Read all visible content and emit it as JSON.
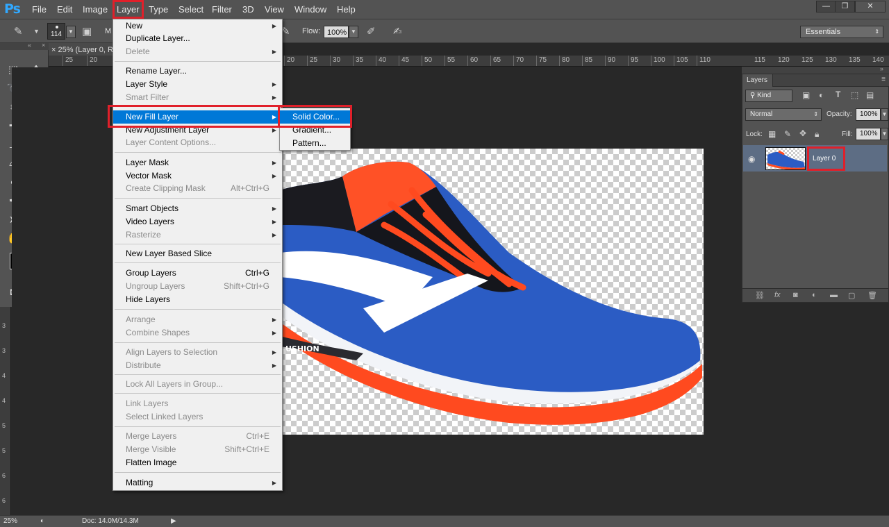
{
  "app": {
    "logo": "Ps"
  },
  "menubar": {
    "items": [
      "File",
      "Edit",
      "Image",
      "Layer",
      "Type",
      "Select",
      "Filter",
      "3D",
      "View",
      "Window",
      "Help"
    ],
    "active": "Layer"
  },
  "window_buttons": {
    "minimize": "—",
    "restore": "❐",
    "close": "✕"
  },
  "options": {
    "brush_size": "114",
    "mode_label": "M",
    "flow_label": "Flow:",
    "flow_value": "100%",
    "workspace": "Essentials"
  },
  "document": {
    "tab_title": "25% (Layer 0, R",
    "ruler_top": [
      "25",
      "20",
      "20",
      "25",
      "30",
      "35",
      "40",
      "45",
      "50",
      "55",
      "60",
      "65",
      "70",
      "75",
      "80",
      "85",
      "90",
      "95",
      "100",
      "105",
      "110"
    ],
    "ruler_right": [
      "115",
      "120",
      "125",
      "130",
      "135",
      "140"
    ],
    "ruler_left": [
      "3",
      "3",
      "4",
      "4",
      "5",
      "5",
      "6",
      "6"
    ]
  },
  "status": {
    "zoom": "25%",
    "doc": "Doc: 14.0M/14.3M"
  },
  "layer_menu": {
    "items": [
      {
        "label": "New",
        "submenu": true
      },
      {
        "label": "Duplicate Layer..."
      },
      {
        "label": "Delete",
        "disabled": true,
        "submenu": true
      },
      {
        "label": "Rename Layer..."
      },
      {
        "label": "Layer Style",
        "submenu": true
      },
      {
        "label": "Smart Filter",
        "disabled": true,
        "submenu": true
      },
      {
        "label": "New Fill Layer",
        "submenu": true,
        "highlighted": true
      },
      {
        "label": "New Adjustment Layer",
        "submenu": true
      },
      {
        "label": "Layer Content Options...",
        "disabled": true
      },
      {
        "label": "Layer Mask",
        "submenu": true
      },
      {
        "label": "Vector Mask",
        "submenu": true
      },
      {
        "label": "Create Clipping Mask",
        "disabled": true,
        "shortcut": "Alt+Ctrl+G"
      },
      {
        "label": "Smart Objects",
        "submenu": true
      },
      {
        "label": "Video Layers",
        "submenu": true
      },
      {
        "label": "Rasterize",
        "disabled": true,
        "submenu": true
      },
      {
        "label": "New Layer Based Slice"
      },
      {
        "label": "Group Layers",
        "shortcut": "Ctrl+G"
      },
      {
        "label": "Ungroup Layers",
        "disabled": true,
        "shortcut": "Shift+Ctrl+G"
      },
      {
        "label": "Hide Layers"
      },
      {
        "label": "Arrange",
        "disabled": true,
        "submenu": true
      },
      {
        "label": "Combine Shapes",
        "disabled": true,
        "submenu": true
      },
      {
        "label": "Align Layers to Selection",
        "disabled": true,
        "submenu": true
      },
      {
        "label": "Distribute",
        "disabled": true,
        "submenu": true
      },
      {
        "label": "Lock All Layers in Group...",
        "disabled": true
      },
      {
        "label": "Link Layers",
        "disabled": true
      },
      {
        "label": "Select Linked Layers",
        "disabled": true
      },
      {
        "label": "Merge Layers",
        "disabled": true,
        "shortcut": "Ctrl+E"
      },
      {
        "label": "Merge Visible",
        "disabled": true,
        "shortcut": "Shift+Ctrl+E"
      },
      {
        "label": "Flatten Image"
      },
      {
        "label": "Matting",
        "submenu": true
      }
    ]
  },
  "fill_submenu": {
    "items": [
      {
        "label": "Solid Color...",
        "highlighted": true
      },
      {
        "label": "Gradient..."
      },
      {
        "label": "Pattern..."
      }
    ]
  },
  "layers_panel": {
    "tab": "Layers",
    "kind": "Kind",
    "blend_mode": "Normal",
    "opacity_label": "Opacity:",
    "opacity_value": "100%",
    "lock_label": "Lock:",
    "fill_label": "Fill:",
    "fill_value": "100%",
    "layers": [
      {
        "name": "Layer 0",
        "visible": true
      }
    ]
  },
  "colors": {
    "highlight_red": "#e0202a",
    "menu_selection": "#0078d7",
    "layer_selected": "#5d6d84",
    "shoe_blue": "#2b5cc4",
    "shoe_orange": "#ff4a1f"
  }
}
